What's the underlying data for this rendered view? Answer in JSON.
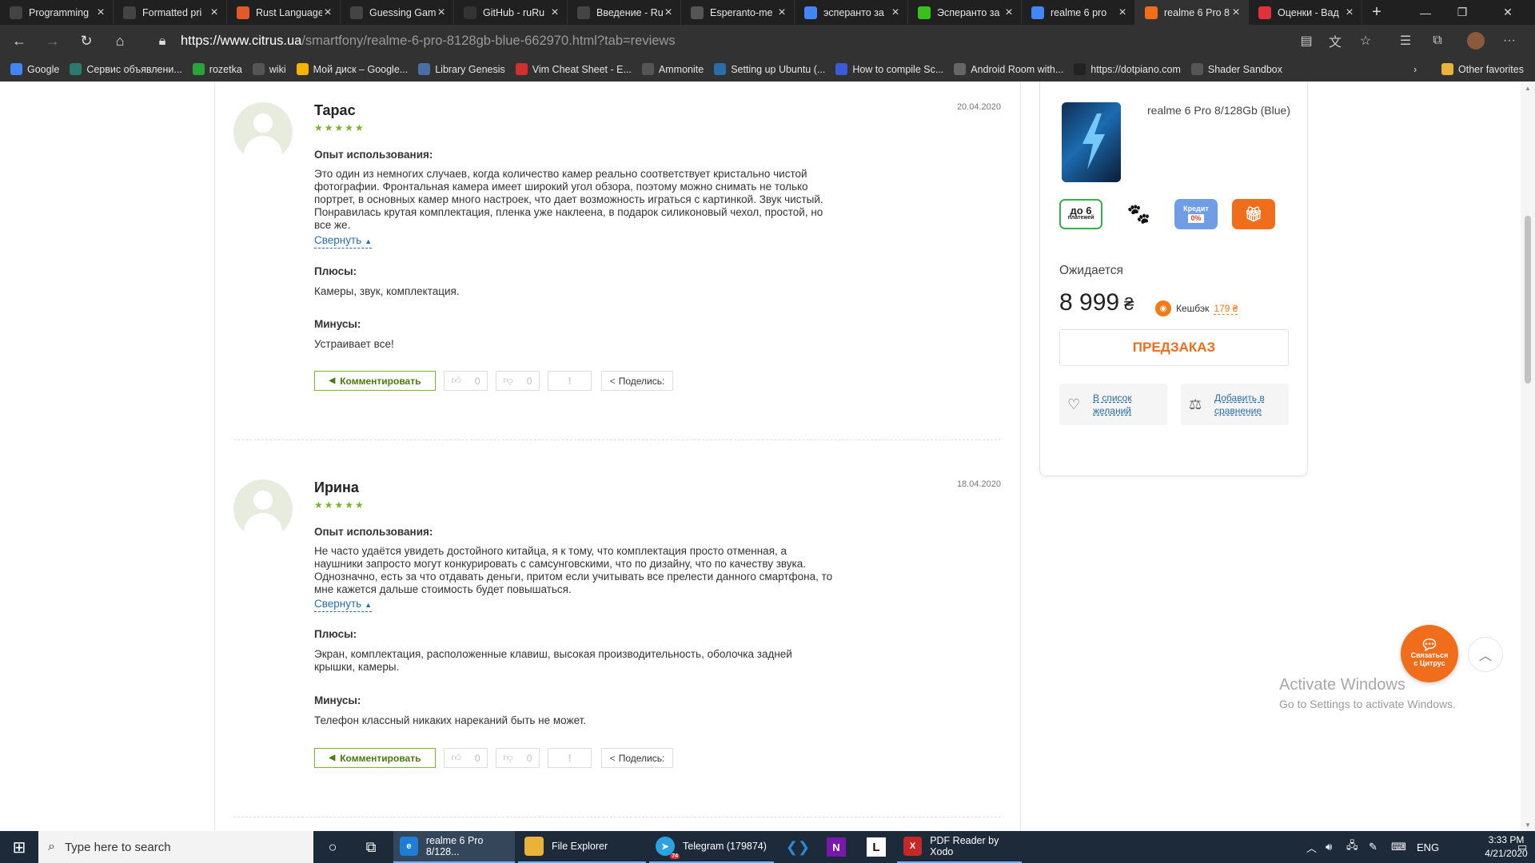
{
  "browser": {
    "tabs": [
      {
        "title": "Programming",
        "favicon": "ai-icon",
        "color": "#444"
      },
      {
        "title": "Formatted pri",
        "favicon": "ai-icon",
        "color": "#444"
      },
      {
        "title": "Rust Language",
        "favicon": "rust-icon",
        "color": "#e05a2b"
      },
      {
        "title": "Guessing Gam",
        "favicon": "ai-icon",
        "color": "#444"
      },
      {
        "title": "GitHub - ruRu",
        "favicon": "github-icon",
        "color": "#333"
      },
      {
        "title": "Введение - Ru",
        "favicon": "ai-icon",
        "color": "#444"
      },
      {
        "title": "Esperanto-me",
        "favicon": "page-icon",
        "color": "#555"
      },
      {
        "title": "эсперанто за",
        "favicon": "google-icon",
        "color": "#4285f4"
      },
      {
        "title": "Эсперанто за",
        "favicon": "star-icon",
        "color": "#3bbf1c"
      },
      {
        "title": "realme 6 pro",
        "favicon": "google-icon",
        "color": "#4285f4"
      },
      {
        "title": "realme 6 Pro 8",
        "favicon": "citrus-icon",
        "color": "#f06d1c"
      },
      {
        "title": "Оценки - Вад",
        "favicon": "ratings-icon",
        "color": "#e0323a"
      }
    ],
    "active_tab": 10,
    "url_host": "https://www.citrus.ua",
    "url_path": "/smartfony/realme-6-pro-8128gb-blue-662970.html?tab=reviews",
    "bookmarks": [
      {
        "label": "Google",
        "icon": "google-icon",
        "color": "#4285f4"
      },
      {
        "label": "Сервис объявлени...",
        "icon": "olx-icon",
        "color": "#2a7a6e"
      },
      {
        "label": "rozetka",
        "icon": "rozetka-icon",
        "color": "#2aa43a"
      },
      {
        "label": "wiki",
        "icon": "wiki-icon",
        "color": "#555"
      },
      {
        "label": "Мой диск – Google...",
        "icon": "drive-icon",
        "color": "#f4b400"
      },
      {
        "label": "Library Genesis",
        "icon": "book-icon",
        "color": "#4a6fa5"
      },
      {
        "label": "Vim Cheat Sheet - E...",
        "icon": "vim-icon",
        "color": "#d32f2f"
      },
      {
        "label": "Ammonite",
        "icon": "at-icon",
        "color": "#555"
      },
      {
        "label": "Setting up Ubuntu (...",
        "icon": "ubuntu-icon",
        "color": "#2a6ea8"
      },
      {
        "label": "How to compile Sc...",
        "icon": "a-icon",
        "color": "#3b5bdb"
      },
      {
        "label": "Android Room with...",
        "icon": "android-icon",
        "color": "#666"
      },
      {
        "label": "https://dotpiano.com",
        "icon": "piano-icon",
        "color": "#222"
      },
      {
        "label": "Shader Sandbox",
        "icon": "page-icon",
        "color": "#555"
      }
    ],
    "other_favorites": "Other favorites"
  },
  "reviews": [
    {
      "name": "Тарас",
      "stars": "★★★★★",
      "date": "20.04.2020",
      "experience_label": "Опыт использования:",
      "experience_lines": [
        "Это один из немногих случаев, когда количество камер реально соответствует кристально чистой",
        "фотографии. Фронтальная камера имеет широкий угол обзора, поэтому можно снимать не только",
        "портрет, в основных камер много настроек, что дает возможность играться с картинкой. Звук чистый.",
        "Понравилась крутая комплектация, пленка уже наклеена, в подарок силиконовый чехол, простой, но",
        "все же."
      ],
      "collapse_label": "Свернуть",
      "pros_label": "Плюсы:",
      "pros": "Камеры, звук, комплектация.",
      "cons_label": "Минусы:",
      "cons": "Устраивает все!",
      "comment_label": "Комментировать",
      "likes": "0",
      "dislikes": "0",
      "flag": "!",
      "share_label": "Поделись:"
    },
    {
      "name": "Ирина",
      "stars": "★★★★★",
      "date": "18.04.2020",
      "experience_label": "Опыт использования:",
      "experience_lines": [
        "Не часто удаётся увидеть достойного китайца, я к тому, что комплектация просто отменная, а",
        "наушники запросто могут конкурировать с самсунговскими, что по дизайну, что по качеству звука.",
        "Однозначно, есть за что отдавать деньги, притом если учитывать все прелести данного смартфона, то",
        "мне кажется дальше стоимость будет повышаться."
      ],
      "collapse_label": "Свернуть",
      "pros_label": "Плюсы:",
      "pros_lines": [
        "Экран, комплектация, расположенные клавиш, высокая производительность, оболочка задней",
        "крышки, камеры."
      ],
      "cons_label": "Минусы:",
      "cons": "Телефон классный никаких нареканий быть не может.",
      "comment_label": "Комментировать",
      "likes": "0",
      "dislikes": "0",
      "flag": "!",
      "share_label": "Поделись:"
    }
  ],
  "product_card": {
    "product_name": "realme 6 Pro 8/128Gb (Blue)",
    "promos": [
      {
        "name": "installments-badge",
        "text": "до 6 платежей"
      },
      {
        "name": "paw-badge",
        "text": ""
      },
      {
        "name": "credit-badge",
        "text": "Кредит 0%"
      },
      {
        "name": "gift-badge",
        "text": ""
      }
    ],
    "status": "Ожидается",
    "price": "8 999",
    "currency": "₴",
    "cashback_label": "Кешбэк",
    "cashback_value": "179 ₴",
    "preorder_label": "ПРЕДЗАКАЗ",
    "wishlist_label_1": "В список",
    "wishlist_label_2": "желаний",
    "compare_label_1": "Добавить в",
    "compare_label_2": "сравнение",
    "accent_color": "#f06d1c",
    "green_color": "#7bb628"
  },
  "floating": {
    "chat_label_1": "Связаться",
    "chat_label_2": "с Цитрус",
    "activate_title": "Activate Windows",
    "activate_sub": "Go to Settings to activate Windows."
  },
  "taskbar": {
    "search_placeholder": "Type here to search",
    "apps": [
      {
        "label": "realme 6 Pro 8/128...",
        "icon": "edge-icon",
        "color": "#1c7ed6"
      },
      {
        "label": "File Explorer",
        "icon": "folder-icon",
        "color": "#e8b339"
      },
      {
        "label": "Telegram (179874)",
        "icon": "telegram-icon",
        "color": "#2aa3e0",
        "badge": "74"
      },
      {
        "label": "PDF Reader by Xodo",
        "icon": "xodo-icon",
        "color": "#c62828"
      }
    ],
    "lang": "ENG",
    "time": "3:33 PM",
    "date": "4/21/2020"
  }
}
